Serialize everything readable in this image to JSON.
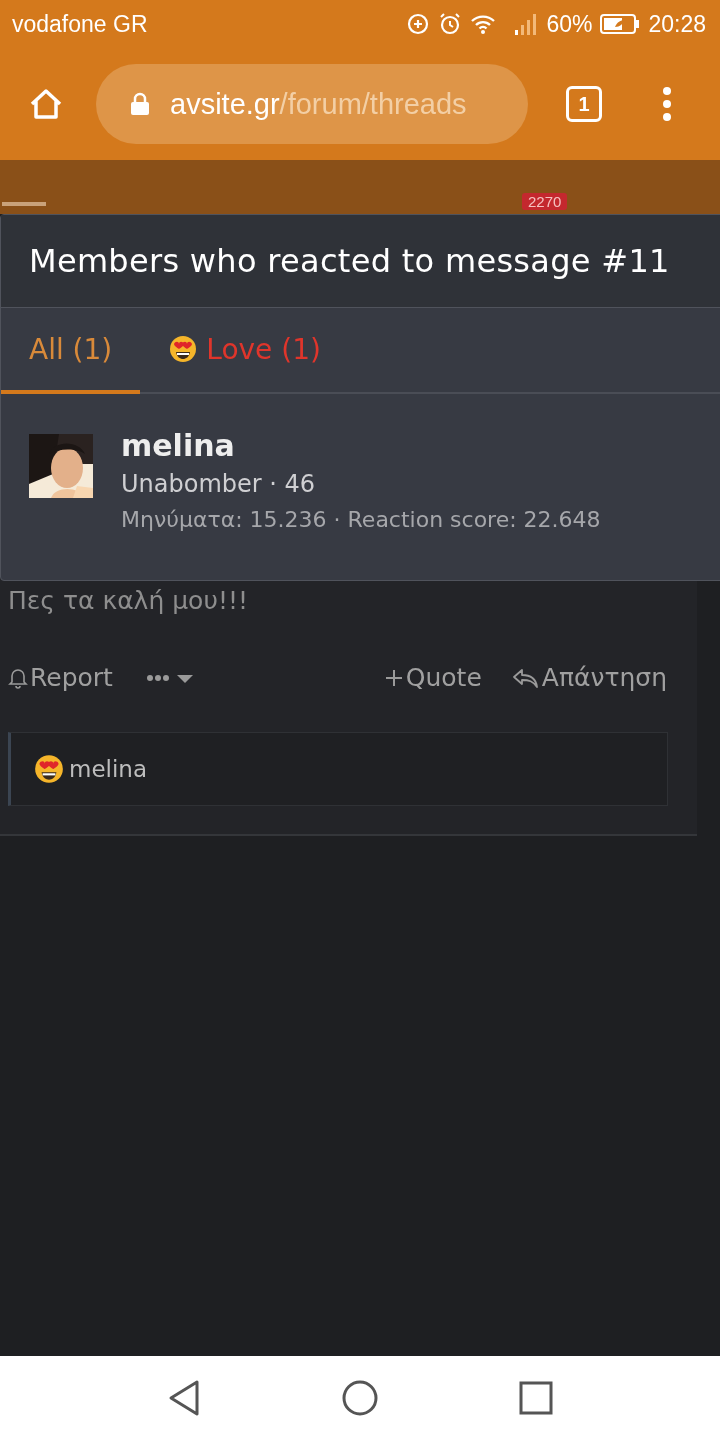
{
  "status_bar": {
    "carrier": "vodafone GR",
    "battery": "60%",
    "time": "20:28"
  },
  "browser": {
    "url_host": "avsite.gr",
    "url_path": "/forum/threads",
    "tab_count": "1"
  },
  "site_header": {
    "badge": "2270"
  },
  "dialog": {
    "title": "Members who reacted to message #11",
    "tabs": [
      {
        "label": "All (1)",
        "kind": "all",
        "selected": true
      },
      {
        "label": "Love (1)",
        "kind": "love",
        "selected": false
      }
    ],
    "members": [
      {
        "name": "melina",
        "title_line": "Unabomber · 46",
        "stats": "Μηνύματα: 15.236 · Reaction score: 22.648"
      }
    ]
  },
  "post": {
    "text": "Πες τα καλή μου!!!",
    "actions": [
      {
        "label": "Report",
        "kind": "report"
      },
      {
        "label": "Quote",
        "kind": "quote"
      },
      {
        "label": "Απάντηση",
        "kind": "reply"
      }
    ],
    "reactions": {
      "user": "melina"
    }
  }
}
